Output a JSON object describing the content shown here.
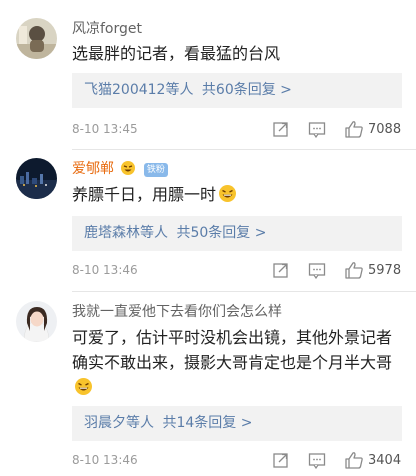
{
  "comments": [
    {
      "username": "风凉forget",
      "text": "选最胖的记者，看最猛的台风",
      "reply_summary": "飞猫200412等人",
      "reply_count": "共60条回复 >",
      "time": "8-10 13:45",
      "likes": "7088",
      "avatar": "avatar-photo"
    },
    {
      "username": "爱郇郸",
      "badge": "铁粉",
      "text": "养膘千日，用膘一时",
      "reply_summary": "鹿塔森林等人",
      "reply_count": "共50条回复 >",
      "time": "8-10 13:46",
      "likes": "5978",
      "avatar": "avatar-night-city"
    },
    {
      "username": "我就一直爱他下去看你们会怎么样",
      "text": "可爱了，估计平时没机会出镜，其他外景记者确实不敢出来，摄影大哥肯定也是个月半大哥",
      "reply_summary": "羽晨夕等人",
      "reply_count": "共14条回复 >",
      "time": "8-10 13:46",
      "likes": "3404",
      "avatar": "avatar-girl"
    }
  ],
  "icons": {
    "share": "share-icon",
    "comment": "comment-icon",
    "like": "thumbs-up-icon",
    "laugh": "laughing-emoji-icon"
  },
  "colors": {
    "link": "#5b7da9",
    "vip_name": "#e86b0f",
    "badge": "#89b9ea",
    "reply_bg": "#f2f2f2"
  }
}
